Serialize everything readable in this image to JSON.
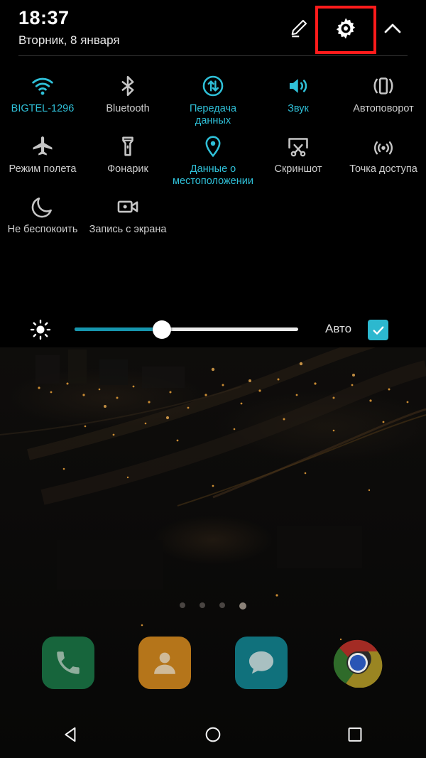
{
  "status_bar": {
    "clock": "18:37",
    "date": "Вторник, 8 января"
  },
  "header": {
    "edit_icon": "pencil-edit-icon",
    "settings_icon": "gear-icon",
    "collapse_icon": "chevron-up-icon",
    "highlight_color": "#ff1b1b",
    "highlighted_target": "gear-icon"
  },
  "colors": {
    "accent_on": "#2fc0d8",
    "label_off": "#cfcfcf",
    "slider_fill": "#1696ae",
    "checkbox": "#2cb8cf",
    "panel_bg": "#000000"
  },
  "quick_settings": {
    "tiles": [
      {
        "label": "BIGTEL-1296",
        "icon": "wifi-icon",
        "state": "on"
      },
      {
        "label": "Bluetooth",
        "icon": "bluetooth-icon",
        "state": "off"
      },
      {
        "label": "Передача данных",
        "icon": "mobile-data-icon",
        "state": "on"
      },
      {
        "label": "Звук",
        "icon": "sound-icon",
        "state": "on"
      },
      {
        "label": "Автоповорот",
        "icon": "auto-rotate-icon",
        "state": "off"
      },
      {
        "label": "Режим полета",
        "icon": "airplane-icon",
        "state": "off"
      },
      {
        "label": "Фонарик",
        "icon": "flashlight-icon",
        "state": "off"
      },
      {
        "label": "Данные о местоположении",
        "icon": "location-pin-icon",
        "state": "on"
      },
      {
        "label": "Скриншот",
        "icon": "screenshot-icon",
        "state": "off"
      },
      {
        "label": "Точка доступа",
        "icon": "hotspot-icon",
        "state": "off"
      },
      {
        "label": "Не беспокоить",
        "icon": "moon-icon",
        "state": "off"
      },
      {
        "label": "Запись с экрана",
        "icon": "screen-record-icon",
        "state": "off"
      }
    ]
  },
  "brightness": {
    "icon": "brightness-icon",
    "value_percent": 39,
    "auto_label": "Авто",
    "auto_checked": true
  },
  "home_screen": {
    "page_dots": {
      "count": 4,
      "active_index": 3
    },
    "dock": [
      {
        "name": "phone-app",
        "icon": "phone-icon",
        "color": "#17653c"
      },
      {
        "name": "contacts-app",
        "icon": "contacts-icon",
        "color": "#b5751a"
      },
      {
        "name": "messages-app",
        "icon": "message-icon",
        "color": "#10717c"
      },
      {
        "name": "chrome-app",
        "icon": "chrome-icon",
        "color": "#d8d8d8"
      }
    ]
  },
  "navigation_bar": {
    "back": "back-triangle-icon",
    "home": "home-circle-icon",
    "recents": "recents-square-icon"
  }
}
